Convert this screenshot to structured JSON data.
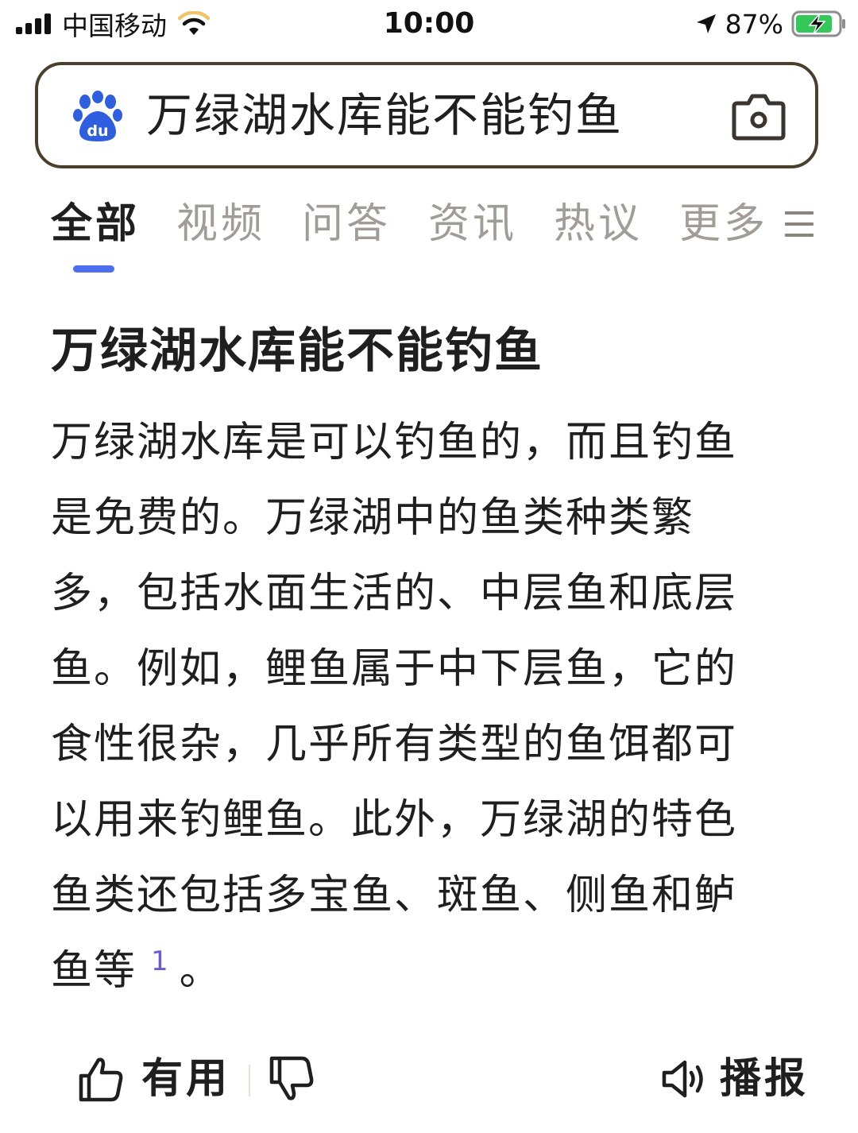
{
  "status_bar": {
    "carrier": "中国移动",
    "time": "10:00",
    "battery": "87%",
    "battery_level": 0.87,
    "icons": [
      "signal-icon",
      "wifi-icon",
      "location-arrow-icon",
      "battery-charging-icon"
    ]
  },
  "search": {
    "query": "万绿湖水库能不能钓鱼",
    "logo_icon": "baidu-paw-icon",
    "camera_icon": "camera-icon"
  },
  "tabs": [
    {
      "label": "全部",
      "active": true
    },
    {
      "label": "视频",
      "active": false
    },
    {
      "label": "问答",
      "active": false
    },
    {
      "label": "资讯",
      "active": false
    },
    {
      "label": "热议",
      "active": false
    },
    {
      "label": "更多",
      "active": false
    }
  ],
  "tabs_menu_icon": "hamburger-menu-icon",
  "colors": {
    "accent": "#4e6ef2",
    "search_border": "#4a3f2c",
    "tab_inactive": "#a19c95",
    "citation": "#6b5bd8",
    "text": "#1f1f1f"
  },
  "result": {
    "title": "万绿湖水库能不能钓鱼",
    "body": "万绿湖水库是可以钓鱼的，而且钓鱼是免费的。万绿湖中的鱼类种类繁多，包括水面生活的、中层鱼和底层鱼。例如，鲤鱼属于中下层鱼，它的食性很杂，几乎所有类型的鱼饵都可以用来钓鲤鱼。此外，万绿湖的特色鱼类还包括多宝鱼、斑鱼、侧鱼和鲈鱼等",
    "citation": "1",
    "ending": "。"
  },
  "actions": {
    "useful_label": "有用",
    "useful_icon": "thumbs-up-icon",
    "dislike_icon": "thumbs-down-icon",
    "broadcast_label": "播报",
    "broadcast_icon": "speaker-icon"
  }
}
